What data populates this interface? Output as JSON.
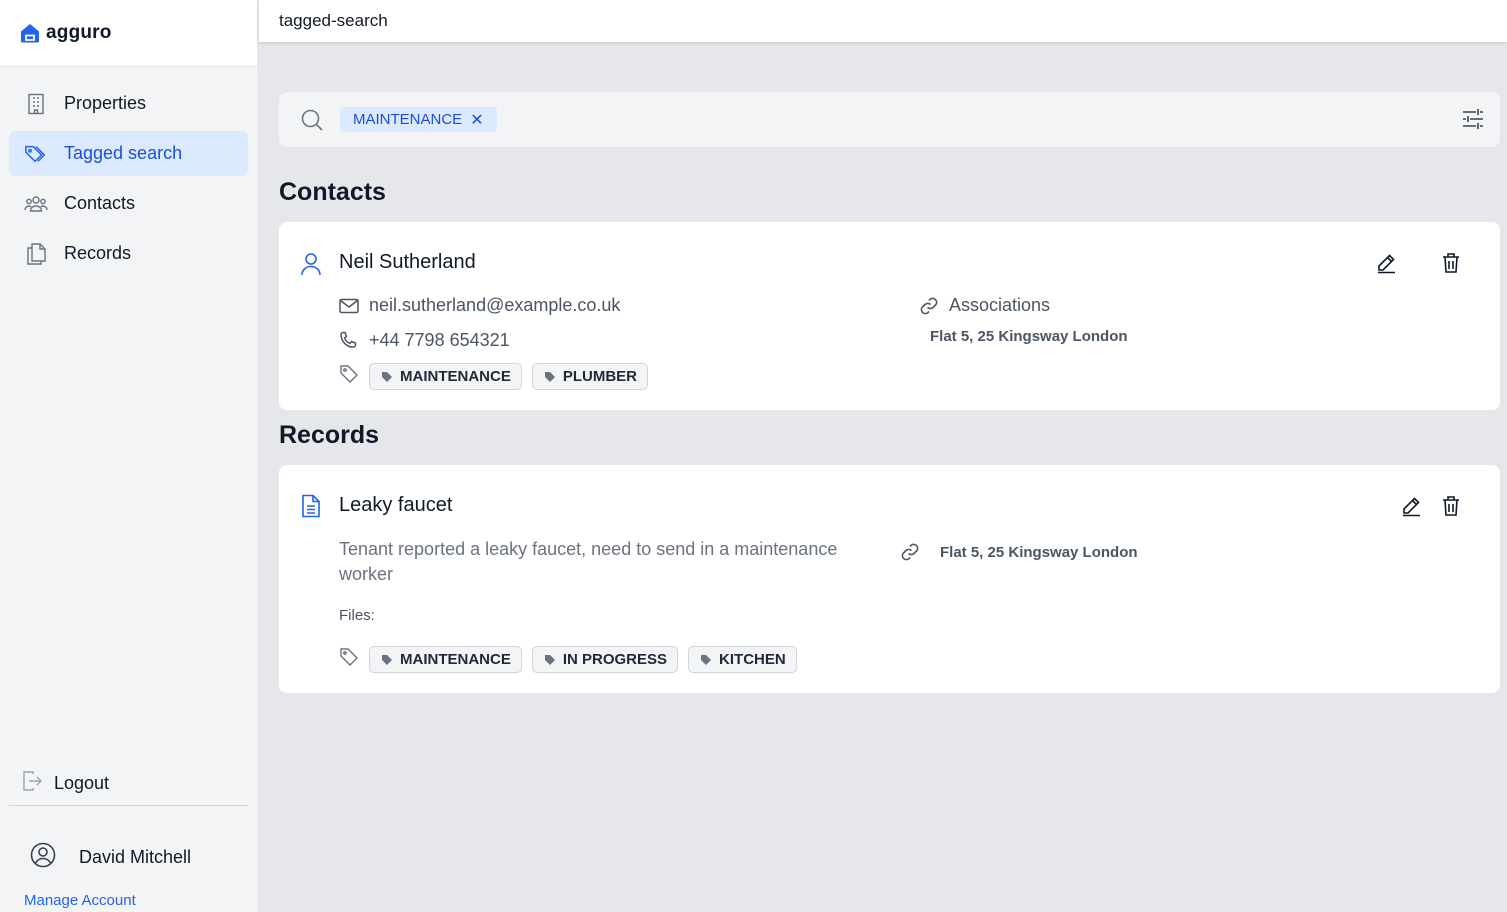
{
  "brand": {
    "name": "agguro"
  },
  "sidebar": {
    "items": [
      {
        "label": "Properties",
        "icon": "building-icon"
      },
      {
        "label": "Tagged search",
        "icon": "tag-icon"
      },
      {
        "label": "Contacts",
        "icon": "users-icon"
      },
      {
        "label": "Records",
        "icon": "documents-icon"
      }
    ],
    "logout_label": "Logout",
    "user_name": "David Mitchell",
    "manage_account": "Manage Account"
  },
  "topbar": {
    "title": "tagged-search"
  },
  "search": {
    "chips": [
      {
        "label": "MAINTENANCE"
      }
    ]
  },
  "sections": {
    "contacts_title": "Contacts",
    "records_title": "Records"
  },
  "contact": {
    "name": "Neil Sutherland",
    "email": "neil.sutherland@example.co.uk",
    "phone": "+44 7798 654321",
    "associations_label": "Associations",
    "association_address": "Flat 5, 25 Kingsway London",
    "tags": [
      "MAINTENANCE",
      "PLUMBER"
    ]
  },
  "record": {
    "title": "Leaky faucet",
    "description": "Tenant reported a leaky faucet, need to send in a maintenance worker",
    "association_address": "Flat 5, 25 Kingsway London",
    "files_label": "Files:",
    "tags": [
      "MAINTENANCE",
      "IN PROGRESS",
      "KITCHEN"
    ]
  },
  "colors": {
    "accent": "#2563eb",
    "active_bg": "#dbeafe",
    "page_bg": "#e5e7eb"
  }
}
